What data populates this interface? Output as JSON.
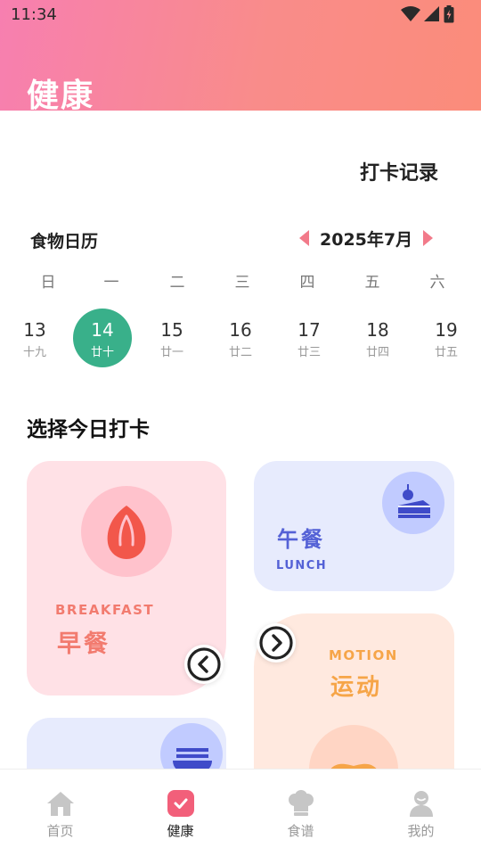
{
  "status_bar": {
    "time": "11:34"
  },
  "header": {
    "title": "健康"
  },
  "checkin_record": "打卡记录",
  "calendar": {
    "label": "食物日历",
    "month": "2025年7月",
    "weekdays": [
      "日",
      "一",
      "二",
      "三",
      "四",
      "五",
      "六"
    ],
    "days": [
      {
        "num": "13",
        "lunar": "十九"
      },
      {
        "num": "14",
        "lunar": "廿十"
      },
      {
        "num": "15",
        "lunar": "廿一"
      },
      {
        "num": "16",
        "lunar": "廿二"
      },
      {
        "num": "17",
        "lunar": "廿三"
      },
      {
        "num": "18",
        "lunar": "廿四"
      },
      {
        "num": "19",
        "lunar": "廿五"
      }
    ],
    "selected_index": 1
  },
  "section_title": "选择今日打卡",
  "cards": {
    "breakfast": {
      "en": "BREAKFAST",
      "cn": "早餐",
      "icon": "almond-icon",
      "color": "#f27b6f"
    },
    "lunch": {
      "cn": "午餐",
      "en": "LUNCH",
      "icon": "cake-icon",
      "color": "#5461d6"
    },
    "motion": {
      "en": "MOTION",
      "cn": "运动",
      "icon": "fitness-icon",
      "color": "#f6a548"
    },
    "dinner": {
      "icon": "bowl-icon"
    }
  },
  "bottom_nav": [
    {
      "label": "首页",
      "icon": "home-icon",
      "active": false
    },
    {
      "label": "健康",
      "icon": "health-check-icon",
      "active": true
    },
    {
      "label": "食谱",
      "icon": "chef-hat-icon",
      "active": false
    },
    {
      "label": "我的",
      "icon": "profile-icon",
      "active": false
    }
  ],
  "colors": {
    "header_start": "#f77fb0",
    "header_end": "#fb8c7a",
    "selected_day": "#39b08a",
    "accent": "#f27a8a"
  }
}
